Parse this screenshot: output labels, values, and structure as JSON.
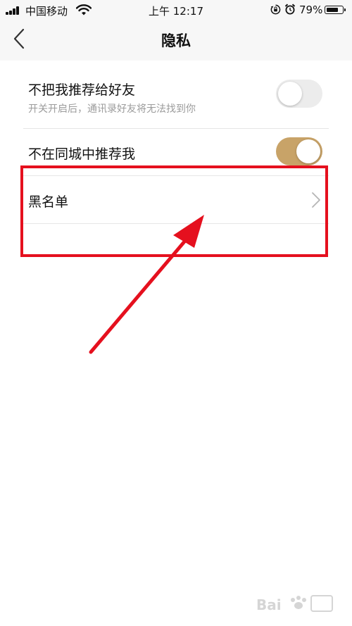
{
  "status_bar": {
    "carrier": "中国移动",
    "time": "上午 12:17",
    "battery_percent": "79%",
    "battery_level": 0.79,
    "icons": [
      "signal-icon",
      "wifi-icon",
      "rotation-lock-icon",
      "alarm-icon",
      "battery-icon"
    ]
  },
  "nav": {
    "title": "隐私",
    "back_icon": "chevron-left-icon"
  },
  "settings": {
    "recommend_to_friends": {
      "label": "不把我推荐给好友",
      "description": "开关开启后，通讯录好友将无法找到你",
      "enabled": false
    },
    "same_city_recommend": {
      "label": "不在同城中推荐我",
      "enabled": true
    },
    "blacklist": {
      "label": "黑名单",
      "icon": "chevron-right-icon"
    }
  },
  "colors": {
    "toggle_on": "#c8a368",
    "toggle_off": "#ececec",
    "annotation": "#e5101e",
    "subtext": "#9b9b9b"
  }
}
